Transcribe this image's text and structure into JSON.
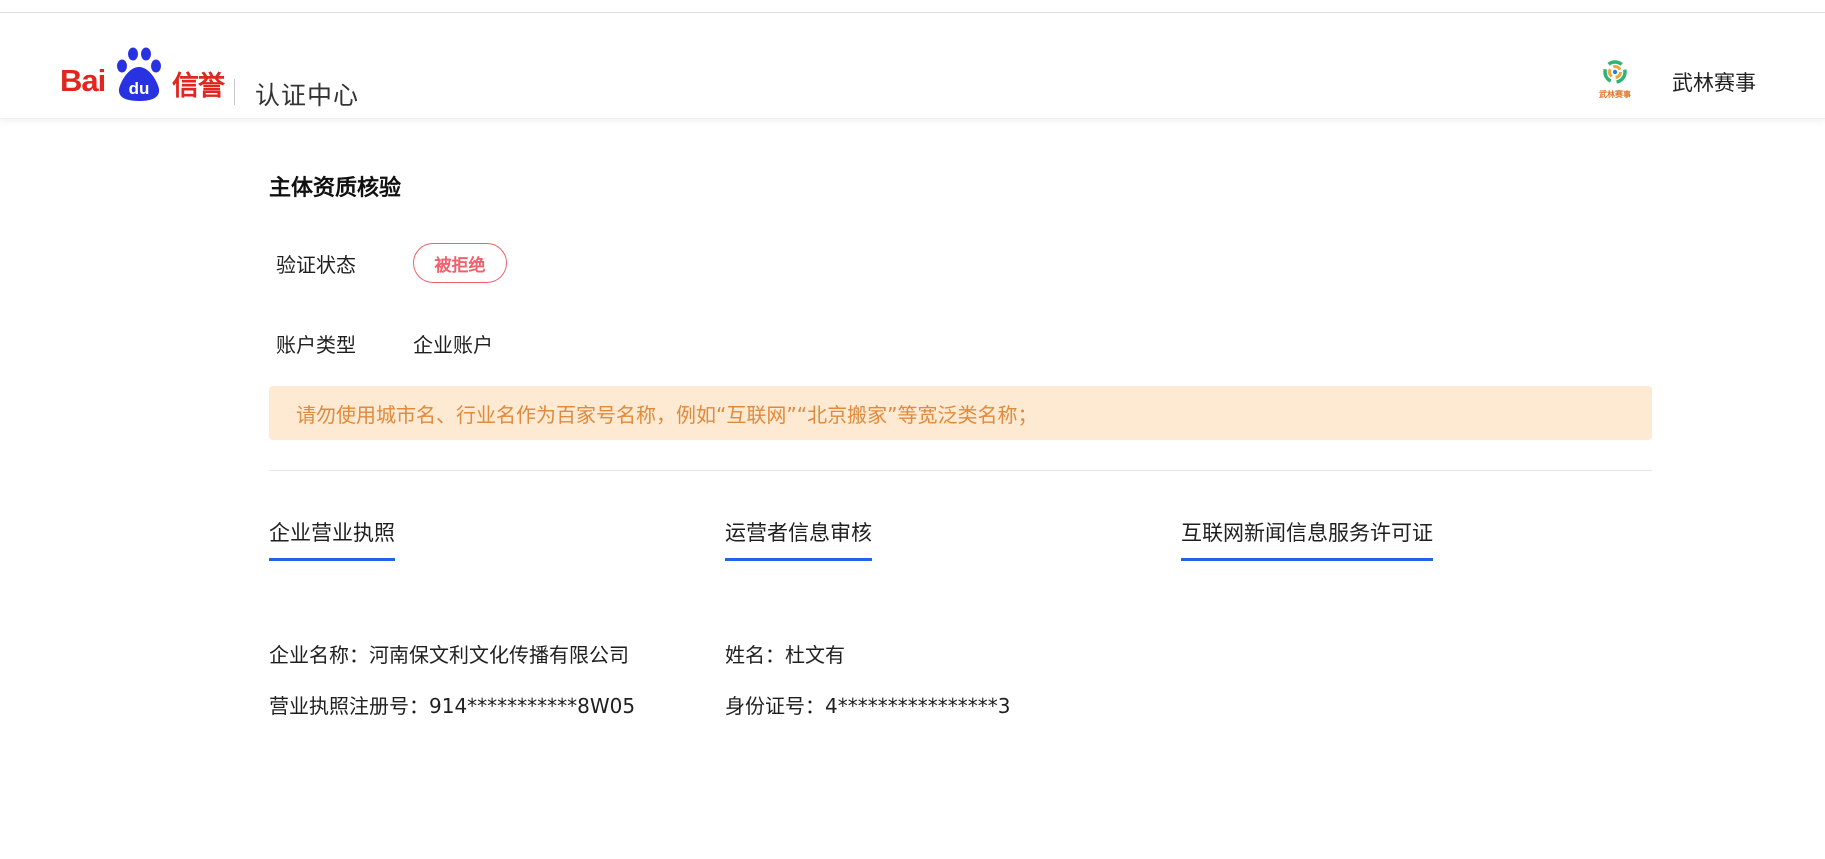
{
  "header": {
    "logo_bai": "Bai",
    "logo_du": "du",
    "logo_xinyu": "信誉",
    "title": "认证中心",
    "avatar_text": "武林赛事",
    "username": "武林赛事"
  },
  "section": {
    "title": "主体资质核验",
    "status_label": "验证状态",
    "status_value": "被拒绝",
    "account_label": "账户类型",
    "account_value": "企业账户",
    "notice": "请勿使用城市名、行业名作为百家号名称，例如“互联网”“北京搬家”等宽泛类名称；"
  },
  "tabs": [
    {
      "label": "企业营业执照"
    },
    {
      "label": "运营者信息审核"
    },
    {
      "label": "互联网新闻信息服务许可证"
    }
  ],
  "company": {
    "name_line": "企业名称：河南保文利文化传播有限公司",
    "license_line": "营业执照注册号：914***********8W05"
  },
  "operator": {
    "name_line": "姓名：杜文有",
    "id_line": "身份证号：4****************3"
  },
  "colors": {
    "brand_red": "#e0261e",
    "brand_blue": "#2932e1",
    "tab_underline": "#2262e6",
    "reject": "#f0616b",
    "notice_bg": "#fee9d2",
    "notice_text": "#e08a3b"
  }
}
